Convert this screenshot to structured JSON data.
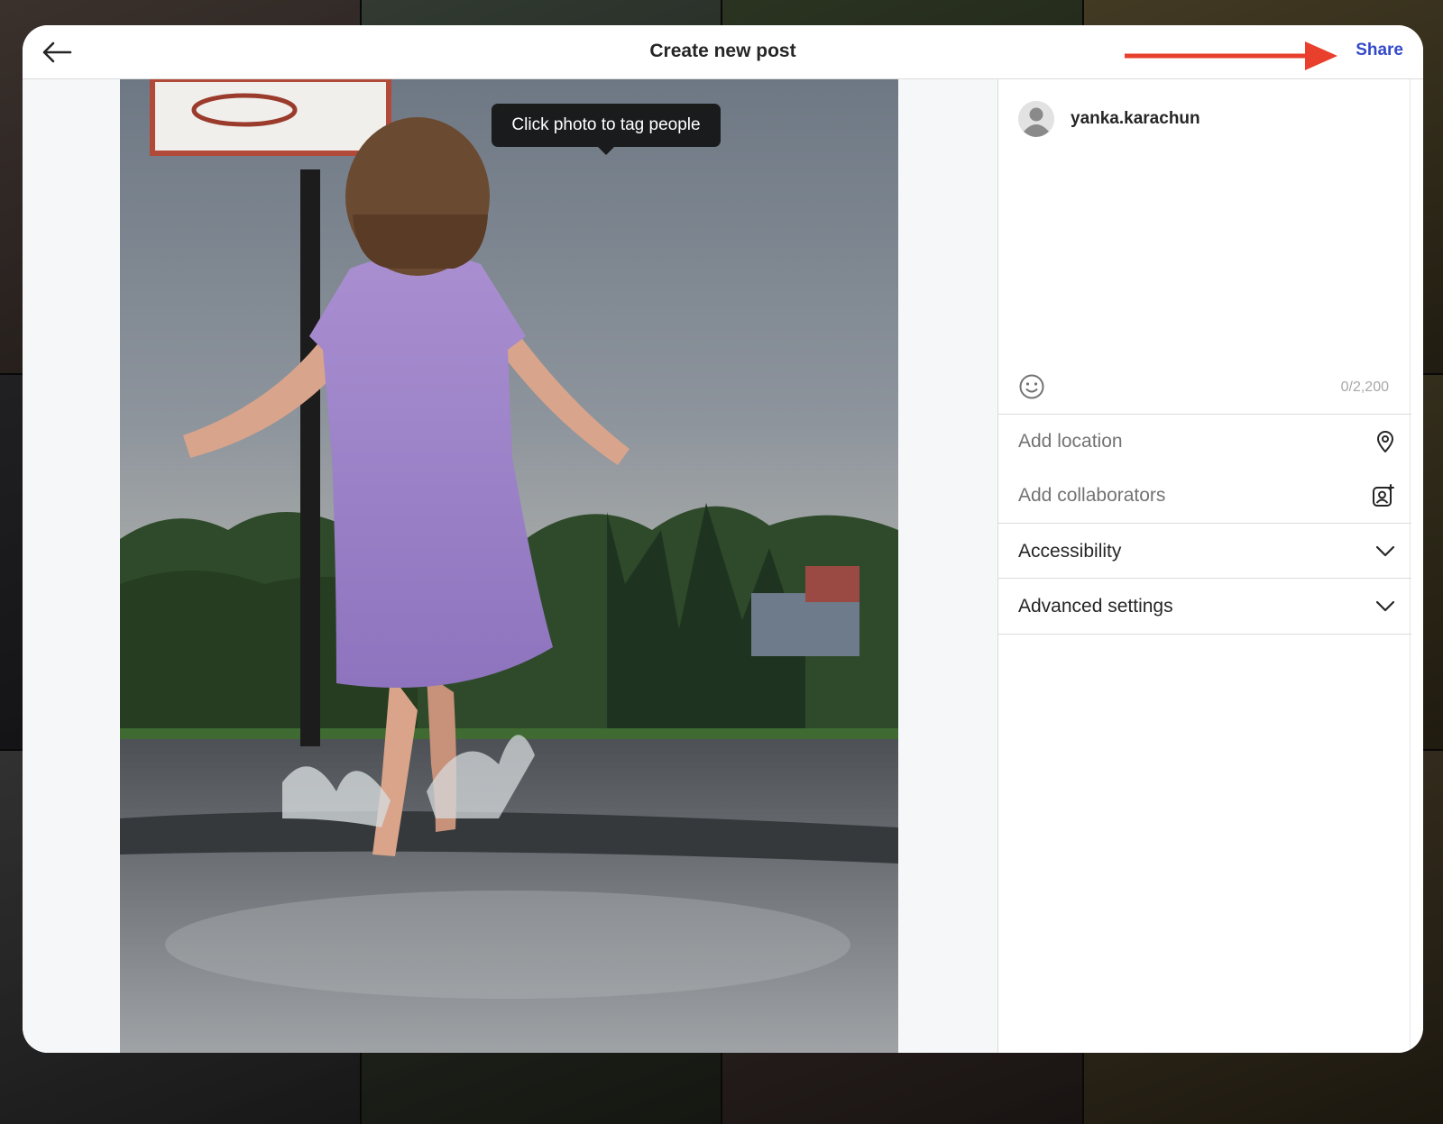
{
  "header": {
    "title": "Create new post",
    "share_label": "Share"
  },
  "photo": {
    "tooltip": "Click photo to tag people"
  },
  "composer": {
    "username": "yanka.karachun",
    "caption_value": "",
    "char_count": "0/2,200"
  },
  "options": {
    "add_location": "Add location",
    "add_collaborators": "Add collaborators",
    "accessibility": "Accessibility",
    "advanced_settings": "Advanced settings"
  },
  "colors": {
    "accent": "#3449c9",
    "annotation_arrow": "#e8402c",
    "border": "#dbdbdb",
    "muted_text": "#737373"
  },
  "icons": {
    "back": "arrow-left-icon",
    "emoji": "smiley-icon",
    "location": "map-pin-icon",
    "collaborators": "person-add-icon",
    "expand": "chevron-down-icon"
  }
}
